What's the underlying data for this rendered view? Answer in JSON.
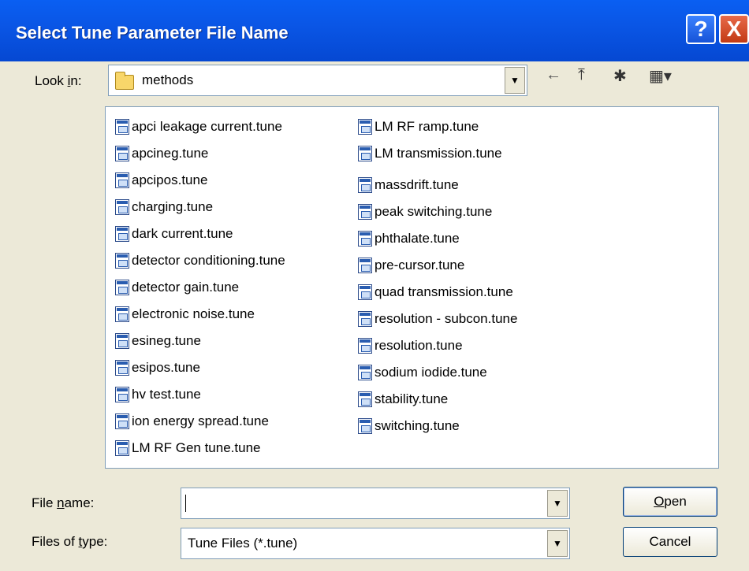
{
  "window": {
    "title": "Select Tune Parameter File Name",
    "help_glyph": "?",
    "close_glyph": "X"
  },
  "look_in": {
    "label_prefix": "Look ",
    "label_accel": "i",
    "label_suffix": "n:",
    "value": "methods",
    "icon": "folder-icon"
  },
  "toolbar": {
    "back_icon": "←",
    "up_icon": "⤒",
    "new_folder_icon": "✱",
    "view_menu_icon": "▦▾"
  },
  "files": {
    "column1": [
      "apci leakage current.tune",
      "apcineg.tune",
      "apcipos.tune",
      "charging.tune",
      "dark current.tune",
      "detector conditioning.tune",
      "detector gain.tune",
      "electronic noise.tune",
      "esineg.tune",
      "esipos.tune",
      "hv test.tune",
      "ion energy spread.tune",
      "LM RF Gen tune.tune"
    ],
    "column2": [
      "LM RF ramp.tune",
      "LM transmission.tune",
      "massdrift.tune",
      "peak switching.tune",
      "phthalate.tune",
      "pre-cursor.tune",
      "quad transmission.tune",
      "resolution - subcon.tune",
      "resolution.tune",
      "sodium iodide.tune",
      "stability.tune",
      "switching.tune"
    ]
  },
  "file_name": {
    "label_prefix": "File ",
    "label_accel": "n",
    "label_suffix": "ame:",
    "value": ""
  },
  "file_type": {
    "label_prefix": "Files of ",
    "label_accel": "t",
    "label_suffix": "ype:",
    "value": "Tune Files (*.tune)"
  },
  "buttons": {
    "open_accel": "O",
    "open_rest": "pen",
    "cancel": "Cancel"
  }
}
